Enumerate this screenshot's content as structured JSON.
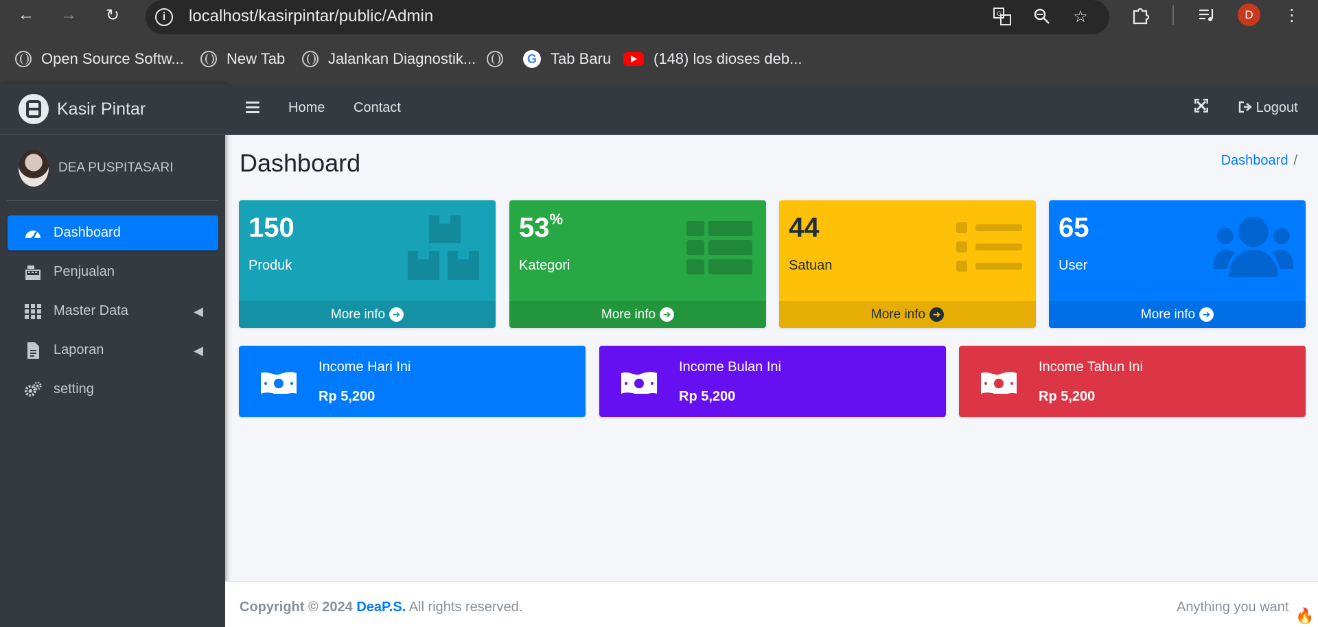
{
  "browser": {
    "url": "localhost/kasirpintar/public/Admin",
    "profile_initial": "D",
    "bookmarks": [
      {
        "label": "Open Source Softw...",
        "icon": "globe-icon"
      },
      {
        "label": "New Tab",
        "icon": "globe-icon"
      },
      {
        "label": "Jalankan Diagnostik...",
        "icon": "globe-icon"
      },
      {
        "label": "",
        "icon": "globe-icon"
      },
      {
        "label": "Tab Baru",
        "icon": "google-icon"
      },
      {
        "label": "(148) los dioses deb...",
        "icon": "youtube-icon"
      }
    ]
  },
  "brand": {
    "name": "Kasir Pintar"
  },
  "user": {
    "name": "DEA PUSPITASARI"
  },
  "sidebar": {
    "items": [
      {
        "label": "Dashboard",
        "icon": "dashboard-icon",
        "active": true
      },
      {
        "label": "Penjualan",
        "icon": "cash-register-icon"
      },
      {
        "label": "Master Data",
        "icon": "grid-icon",
        "has_submenu": true
      },
      {
        "label": "Laporan",
        "icon": "file-icon",
        "has_submenu": true
      },
      {
        "label": "setting",
        "icon": "gears-icon"
      }
    ]
  },
  "navbar": {
    "links": [
      "Home",
      "Contact"
    ],
    "logout_label": "Logout"
  },
  "page": {
    "title": "Dashboard",
    "breadcrumb": "Dashboard",
    "breadcrumb_sep": "/"
  },
  "stat_boxes": [
    {
      "value": "150",
      "suffix": "",
      "label": "Produk",
      "more": "More info",
      "color": "#17a2b8",
      "icon": "boxes-icon"
    },
    {
      "value": "53",
      "suffix": "%",
      "label": "Kategori",
      "more": "More info",
      "color": "#28a745",
      "icon": "table-list-icon"
    },
    {
      "value": "44",
      "suffix": "",
      "label": "Satuan",
      "more": "More info",
      "color": "#ffc107",
      "icon": "list-icon"
    },
    {
      "value": "65",
      "suffix": "",
      "label": "User",
      "more": "More info",
      "color": "#007bff",
      "icon": "users-icon"
    }
  ],
  "income_boxes": [
    {
      "title": "Income Hari Ini",
      "value": "Rp 5,200",
      "color": "#007bff",
      "icon": "money-bill-icon"
    },
    {
      "title": "Income Bulan Ini",
      "value": "Rp 5,200",
      "color": "#6610f2",
      "icon": "money-bill-icon"
    },
    {
      "title": "Income Tahun Ini",
      "value": "Rp 5,200",
      "color": "#dc3545",
      "icon": "money-bill-icon"
    }
  ],
  "footer": {
    "copyright": "Copyright © 2024",
    "brand": "DeaP.S.",
    "rights": "All rights reserved.",
    "right_text": "Anything you want"
  }
}
